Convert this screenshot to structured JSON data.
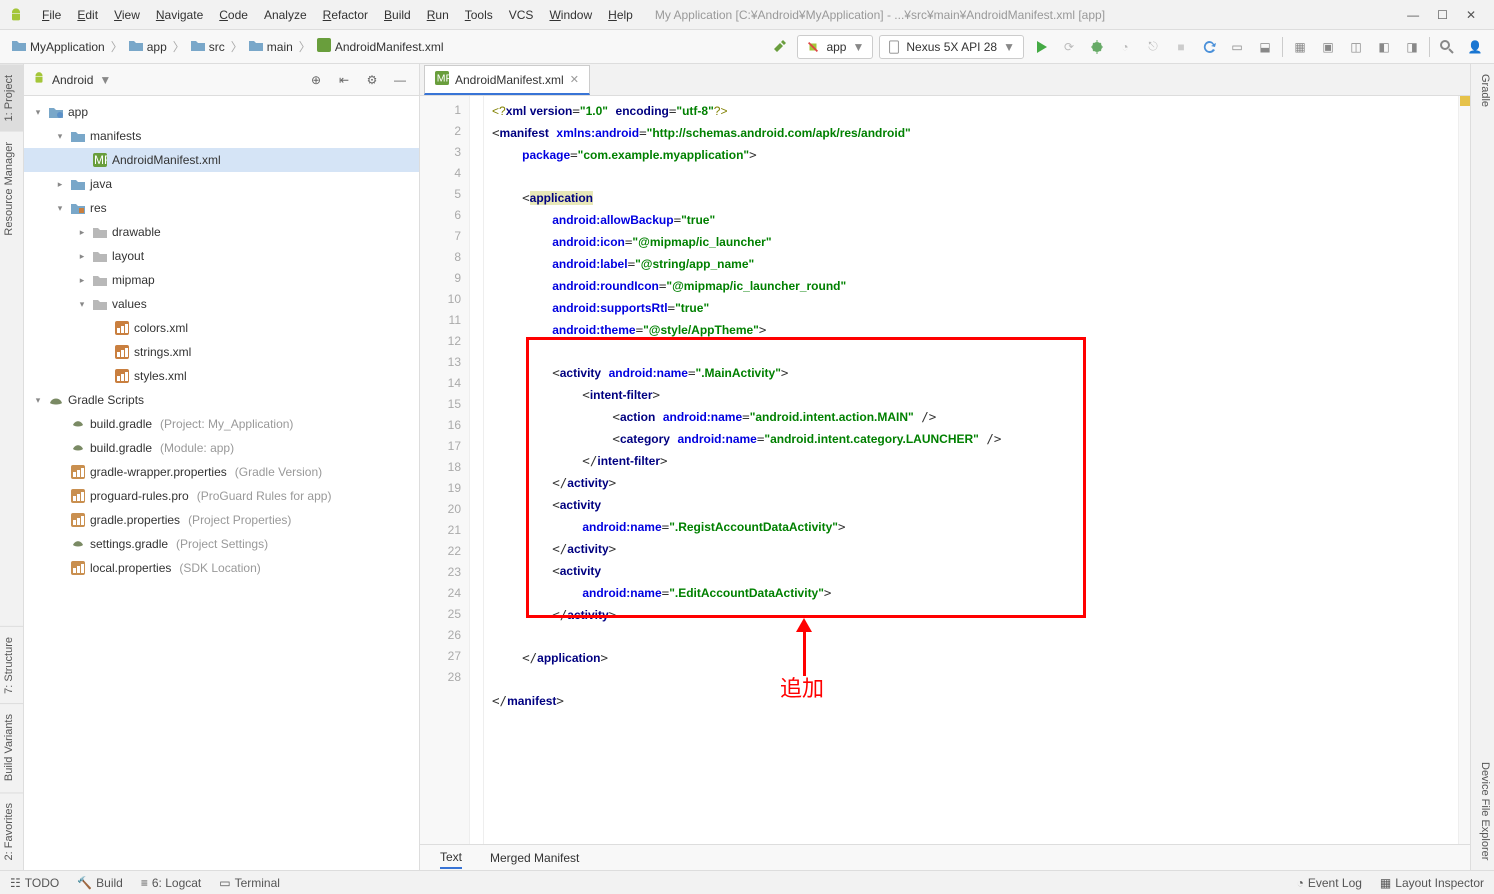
{
  "menu": {
    "items": [
      "File",
      "Edit",
      "View",
      "Navigate",
      "Code",
      "Analyze",
      "Refactor",
      "Build",
      "Run",
      "Tools",
      "VCS",
      "Window",
      "Help"
    ],
    "underlines": [
      "F",
      "E",
      "V",
      "N",
      "C",
      null,
      "R",
      "B",
      "R",
      "T",
      null,
      "W",
      "H"
    ],
    "title": "My Application [C:¥Android¥MyApplication] - ...¥src¥main¥AndroidManifest.xml [app]"
  },
  "breadcrumbs": [
    {
      "icon": "project",
      "label": "MyApplication"
    },
    {
      "icon": "module",
      "label": "app"
    },
    {
      "icon": "folder",
      "label": "src"
    },
    {
      "icon": "folder",
      "label": "main"
    },
    {
      "icon": "xml",
      "label": "AndroidManifest.xml"
    }
  ],
  "runcfg": {
    "module": "app",
    "avd": "Nexus 5X API 28"
  },
  "leftTabs": [
    "1: Project",
    "Resource Manager",
    "7: Structure",
    "Build Variants",
    "2: Favorites"
  ],
  "rightTabs": [
    "Gradle",
    "Device File Explorer"
  ],
  "projHeader": {
    "view": "Android"
  },
  "tree": [
    {
      "d": 0,
      "t": "▾",
      "ic": "module",
      "label": "app"
    },
    {
      "d": 1,
      "t": "▾",
      "ic": "folder",
      "label": "manifests"
    },
    {
      "d": 2,
      "t": "",
      "ic": "xml",
      "label": "AndroidManifest.xml",
      "sel": true
    },
    {
      "d": 1,
      "t": "▸",
      "ic": "folder",
      "label": "java"
    },
    {
      "d": 1,
      "t": "▾",
      "ic": "folder-res",
      "label": "res"
    },
    {
      "d": 2,
      "t": "▸",
      "ic": "folder2",
      "label": "drawable"
    },
    {
      "d": 2,
      "t": "▸",
      "ic": "folder2",
      "label": "layout"
    },
    {
      "d": 2,
      "t": "▸",
      "ic": "folder2",
      "label": "mipmap"
    },
    {
      "d": 2,
      "t": "▾",
      "ic": "folder2",
      "label": "values"
    },
    {
      "d": 3,
      "t": "",
      "ic": "xmlf",
      "label": "colors.xml"
    },
    {
      "d": 3,
      "t": "",
      "ic": "xmlf",
      "label": "strings.xml"
    },
    {
      "d": 3,
      "t": "",
      "ic": "xmlf",
      "label": "styles.xml"
    },
    {
      "d": 0,
      "t": "▾",
      "ic": "gradle",
      "label": "Gradle Scripts"
    },
    {
      "d": 1,
      "t": "",
      "ic": "gfile",
      "label": "build.gradle",
      "hint": "(Project: My_Application)"
    },
    {
      "d": 1,
      "t": "",
      "ic": "gfile",
      "label": "build.gradle",
      "hint": "(Module: app)"
    },
    {
      "d": 1,
      "t": "",
      "ic": "pfile",
      "label": "gradle-wrapper.properties",
      "hint": "(Gradle Version)"
    },
    {
      "d": 1,
      "t": "",
      "ic": "pfile",
      "label": "proguard-rules.pro",
      "hint": "(ProGuard Rules for app)"
    },
    {
      "d": 1,
      "t": "",
      "ic": "pfile",
      "label": "gradle.properties",
      "hint": "(Project Properties)"
    },
    {
      "d": 1,
      "t": "",
      "ic": "gfile",
      "label": "settings.gradle",
      "hint": "(Project Settings)"
    },
    {
      "d": 1,
      "t": "",
      "ic": "pfile",
      "label": "local.properties",
      "hint": "(SDK Location)"
    }
  ],
  "editorTab": {
    "name": "AndroidManifest.xml"
  },
  "lineCount": 28,
  "bottomTabs": {
    "items": [
      "Text",
      "Merged Manifest"
    ],
    "active": 0
  },
  "annotation": "追加",
  "status": {
    "items": [
      "TODO",
      "Build",
      "6: Logcat",
      "Terminal"
    ],
    "right": [
      "Event Log",
      "Layout Inspector"
    ]
  }
}
